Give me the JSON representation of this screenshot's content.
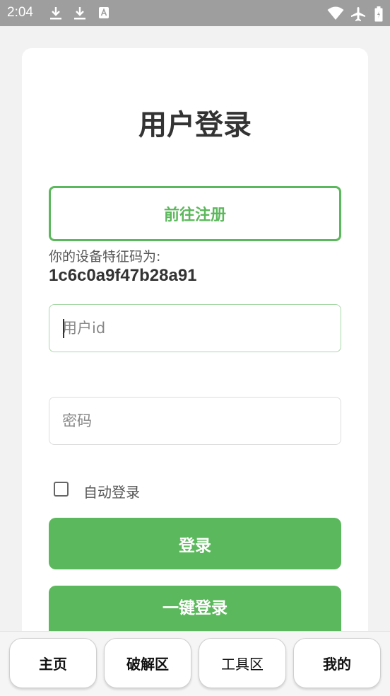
{
  "status_bar": {
    "time": "2:04",
    "left_icons": [
      "download-icon",
      "download-icon",
      "text-notification-icon"
    ],
    "right_icons": [
      "wifi-icon",
      "airplane-icon",
      "battery-icon"
    ]
  },
  "login": {
    "title": "用户登录",
    "register_label": "前往注册",
    "device_label": "你的设备特征码为:",
    "device_code": "1c6c0a9f47b28a91",
    "user_id_placeholder": "用户id",
    "password_placeholder": "密码",
    "auto_login_label": "自动登录",
    "auto_login_checked": false,
    "login_label": "登录",
    "quick_login_label": "一键登录"
  },
  "nav": {
    "items": [
      {
        "label": "主页"
      },
      {
        "label": "破解区"
      },
      {
        "label": "工具区"
      },
      {
        "label": "我的"
      }
    ]
  },
  "colors": {
    "accent": "#5cb85c",
    "status_bar": "#9e9e9e",
    "background": "#f2f2f2"
  }
}
